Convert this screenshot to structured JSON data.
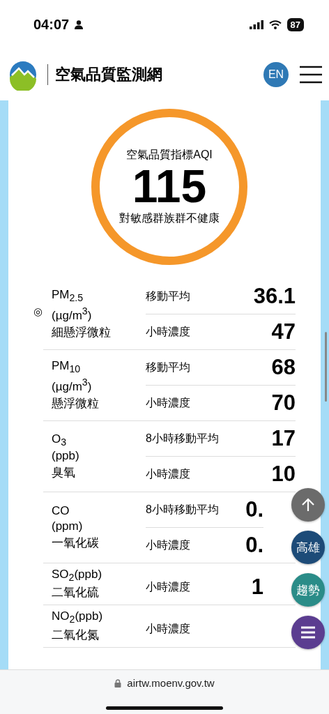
{
  "status_bar": {
    "time": "04:07",
    "battery": "87"
  },
  "header": {
    "title": "空氣品質監測網",
    "language_button": "EN"
  },
  "aqi": {
    "label": "空氣品質指標AQI",
    "value": "115",
    "status": "對敏感群族群不健康",
    "color": "#f5972a"
  },
  "pollutants": [
    {
      "name": "PM$_{2.5}$",
      "marker": "◎",
      "unit": "(µg/m$^{3}$)",
      "zh": "細懸浮微粒",
      "readings": [
        {
          "label": "移動平均",
          "value": "36.1"
        },
        {
          "label": "小時濃度",
          "value": "47"
        }
      ]
    },
    {
      "name": "PM$_{10}$",
      "unit": "(µg/m$^{3}$)",
      "zh": "懸浮微粒",
      "readings": [
        {
          "label": "移動平均",
          "value": "68"
        },
        {
          "label": "小時濃度",
          "value": "70"
        }
      ]
    },
    {
      "name": "O$_{3}$",
      "unit": "(ppb)",
      "zh": "臭氧",
      "readings": [
        {
          "label": "8小時移動平均",
          "value": "17"
        },
        {
          "label": "小時濃度",
          "value": "10"
        }
      ]
    },
    {
      "name": "CO",
      "unit": "(ppm)",
      "zh": "一氧化碳",
      "readings": [
        {
          "label": "8小時移動平均",
          "value": "0."
        },
        {
          "label": "小時濃度",
          "value": "0."
        }
      ]
    },
    {
      "name": "SO$_{2}$(ppb)",
      "zh": "二氧化硫",
      "readings": [
        {
          "label": "小時濃度",
          "value": "1"
        }
      ]
    },
    {
      "name": "NO$_{2}$(ppb)",
      "zh": "二氧化氮",
      "readings": [
        {
          "label": "小時濃度"
        }
      ]
    }
  ],
  "floating_buttons": [
    {
      "kind": "icon",
      "color": "#6b6b6b"
    },
    {
      "kind": "text",
      "label": "高雄",
      "color": "#1d4b78"
    },
    {
      "kind": "text",
      "label": "趨勢",
      "color": "#2a8c88"
    },
    {
      "kind": "menu",
      "color": "#5b3d90"
    }
  ],
  "address_bar": {
    "url": "airtw.moenv.gov.tw"
  }
}
